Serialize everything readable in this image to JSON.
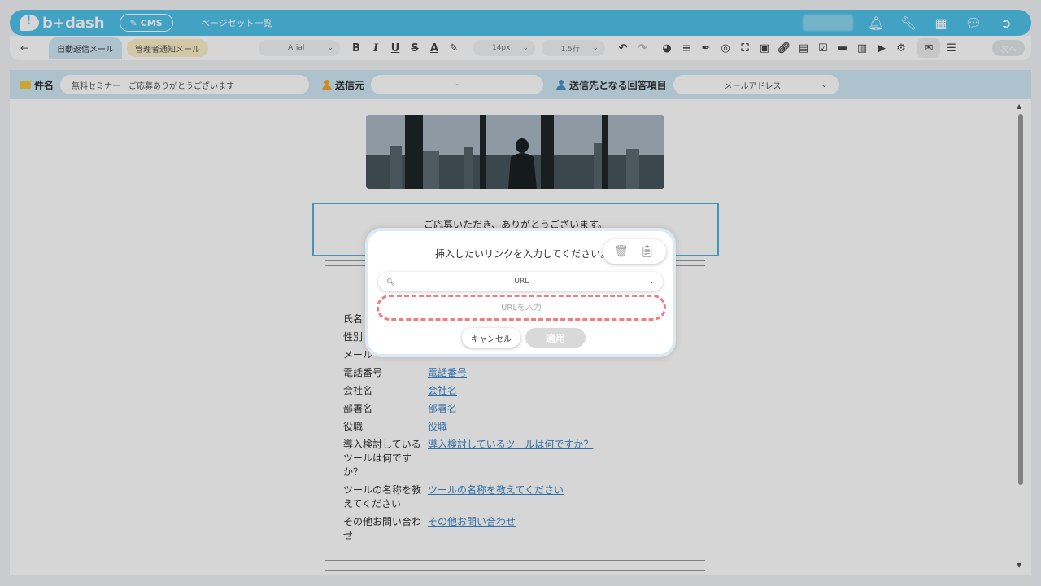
{
  "header": {
    "logo_text": "b+dash",
    "cms_label": "CMS",
    "page_link": "ページセット一覧",
    "icons": [
      "bell-icon",
      "wrench-icon",
      "grid-icon",
      "chat-icon",
      "logout-icon"
    ]
  },
  "toolbar": {
    "back_icon": "←",
    "tabs": [
      {
        "label": "自動返信メール",
        "active": true
      },
      {
        "label": "管理者通知メール",
        "active": false
      }
    ],
    "font_family": "Arial",
    "font_size": "14px",
    "line_height": "1.5行",
    "next_label": "次へ"
  },
  "fields": {
    "subject_label": "件名",
    "subject_value": "無料セミナー　ご応募ありがとうございます",
    "sender_label": "送信元",
    "sender_value": "-",
    "recipient_label": "送信先となる回答項目",
    "recipient_value": "メールアドレス"
  },
  "email": {
    "message": "ご応募いただき、ありがとうございます。",
    "rows": [
      {
        "key": "氏名",
        "value": ""
      },
      {
        "key": "性別",
        "value": ""
      },
      {
        "key": "メール",
        "value": ""
      },
      {
        "key": "電話番号",
        "value": "電話番号"
      },
      {
        "key": "会社名",
        "value": "会社名"
      },
      {
        "key": "部署名",
        "value": "部署名"
      },
      {
        "key": "役職",
        "value": "役職"
      },
      {
        "key": "導入検討しているツールは何ですか？",
        "value": "導入検討しているツールは何ですか？"
      },
      {
        "key": "ツールの名称を教えてください",
        "value": "ツールの名称を教えてください"
      },
      {
        "key": "その他お問い合わせ",
        "value": "その他お問い合わせ"
      }
    ]
  },
  "modal": {
    "title": "挿入したいリンクを入力してください。",
    "select_value": "URL",
    "input_placeholder": "URLを入力",
    "cancel_label": "キャンセル",
    "apply_label": "適用"
  }
}
